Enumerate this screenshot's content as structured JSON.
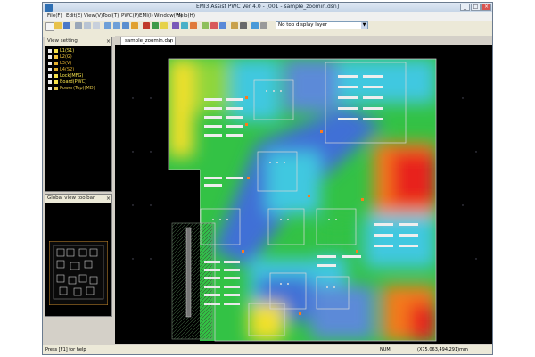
{
  "window": {
    "title": "EMI3 Assist PWC Ver 4.0 - [001 - sample_zoomin.dsn]",
    "min_label": "_",
    "max_label": "□",
    "close_label": "×"
  },
  "menu": [
    "File(F)",
    "Edit(E)",
    "View(V)",
    "Tool(T)",
    "PWC(P)",
    "EMI(I)",
    "Window(W)",
    "Help(H)"
  ],
  "toolbar": {
    "layer_select_value": "No top display layer",
    "layer_select_arrow": "▼"
  },
  "layer_panel": {
    "title": "View setting",
    "close_label": "×",
    "items": [
      {
        "label": "L1(S1)",
        "swatch": "#f5e14a"
      },
      {
        "label": "L2(G)",
        "swatch": "#f2c43c"
      },
      {
        "label": "L3(V)",
        "swatch": "#e6b230"
      },
      {
        "label": "L4(S2)",
        "swatch": "#dfae2a"
      },
      {
        "label": "Lock(MFG)",
        "swatch": "#f5e14a"
      },
      {
        "label": "Board(PWC)",
        "swatch": "#f5e14a"
      },
      {
        "label": "Power(Top)(MD)",
        "swatch": "#e2c54a"
      }
    ]
  },
  "overview_panel": {
    "title": "Global view toolbar",
    "close_label": "×"
  },
  "document_tab": {
    "label": "sample_zoomin.dsn",
    "close_label": "×"
  },
  "status": {
    "help": "Press [F1] for help",
    "mode": "NUM",
    "coords": "(X75.063,494.291)mm"
  },
  "colors": {
    "heat_blue": "#3f6fd6",
    "heat_cyan": "#40c8e0",
    "heat_green": "#33c245",
    "heat_yellow": "#f2e02a",
    "heat_orange": "#f47a1a",
    "heat_red": "#e8231a"
  }
}
